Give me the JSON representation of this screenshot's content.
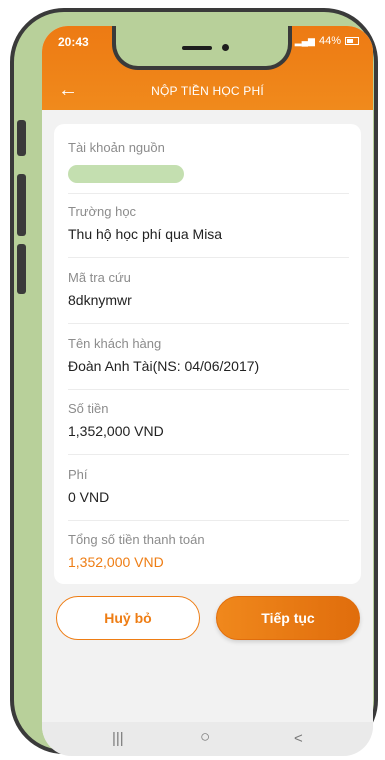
{
  "status": {
    "time": "20:43",
    "battery": "44%"
  },
  "header": {
    "title": "NỘP TIỀN HỌC PHÍ"
  },
  "fields": [
    {
      "label": "Tài khoản nguồn",
      "value": ""
    },
    {
      "label": "Trường học",
      "value": "Thu hộ học phí qua Misa"
    },
    {
      "label": "Mã tra cứu",
      "value": "8dknymwr"
    },
    {
      "label": "Tên khách hàng",
      "value": "Đoàn Anh Tài(NS: 04/06/2017)"
    },
    {
      "label": "Số tiền",
      "value": "1,352,000 VND"
    },
    {
      "label": "Phí",
      "value": "0 VND"
    },
    {
      "label": "Tổng số tiền thanh toán",
      "value": "1,352,000 VND"
    }
  ],
  "buttons": {
    "cancel": "Huỷ bỏ",
    "continue": "Tiếp tục"
  },
  "nav": {
    "recents": "|||",
    "home": "○",
    "back": "<"
  },
  "colors": {
    "accent": "#ee7d14",
    "frame": "#b8d09a"
  }
}
